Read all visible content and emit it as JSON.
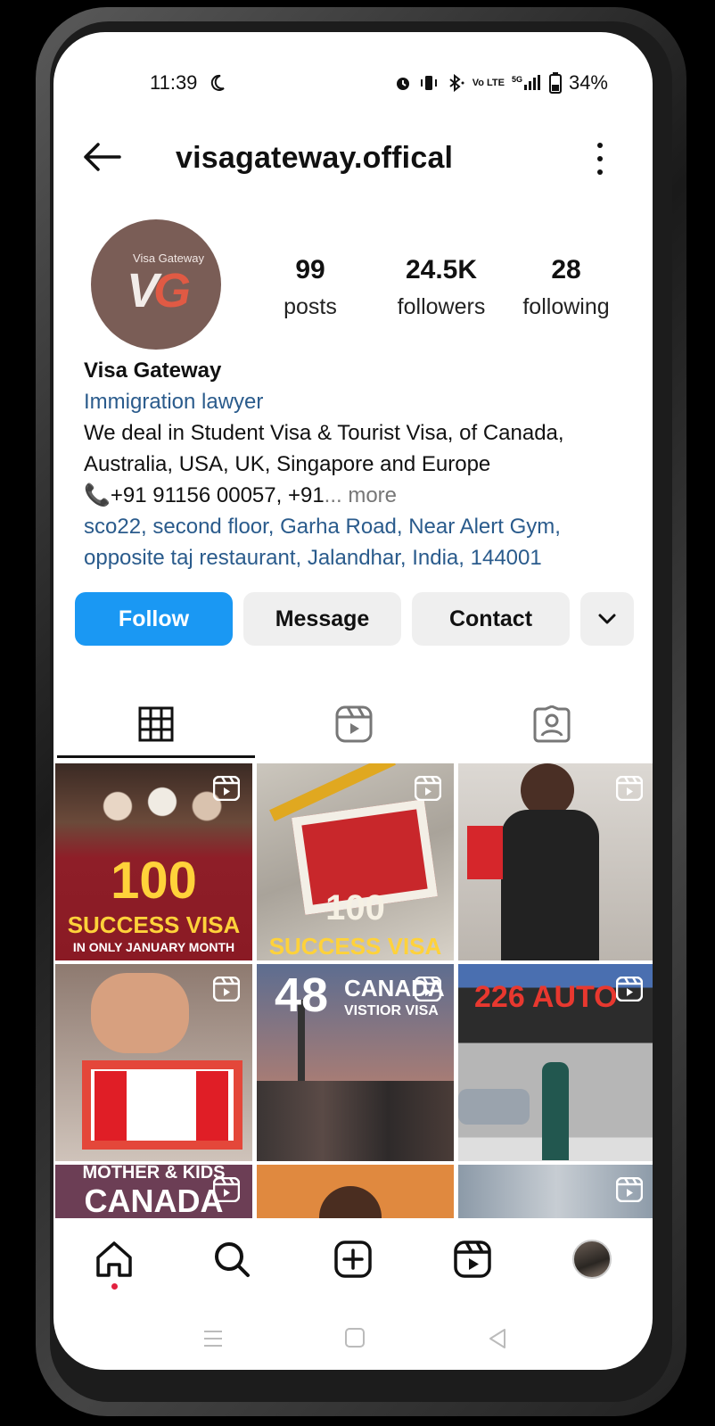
{
  "status_bar": {
    "time": "11:39",
    "battery_pct": "34%",
    "moon_icon": "moon-icon",
    "network_label": "5G",
    "volte_label": "Vo LTE"
  },
  "header": {
    "username": "visagateway.offical"
  },
  "profile": {
    "avatar_brand": "Visa Gateway",
    "avatar_logo_v": "V",
    "avatar_logo_g": "G",
    "posts_count": "99",
    "posts_label": "posts",
    "followers_count": "24.5K",
    "followers_label": "followers",
    "following_count": "28",
    "following_label": "following",
    "display_name": "Visa Gateway",
    "category": "Immigration lawyer",
    "bio_line1": "We deal in Student Visa & Tourist Visa, of Canada,",
    "bio_line2": "Australia, USA, UK, Singapore and Europe",
    "phone_line": "📞+91 91156 00057, +91",
    "more_label": "... more",
    "address_line1": "sco22, second floor, Garha Road, Near Alert Gym,",
    "address_line2": "opposite taj restaurant, Jalandhar, India, 144001"
  },
  "actions": {
    "follow": "Follow",
    "message": "Message",
    "contact": "Contact"
  },
  "grid": {
    "post1_line1": "100",
    "post1_line2": "SUCCESS VISA",
    "post1_line3": "IN ONLY JANUARY MONTH",
    "post2_line1": "100",
    "post2_line2": "SUCCESS VISA",
    "post4_text": "",
    "post5_line1": "48",
    "post5_line2": "CANADA",
    "post5_line3": "VISTIOR VISA",
    "post6_line1": "226 AUTO",
    "post7_line1": "MOTHER & KIDS",
    "post7_line2": "CANADA"
  },
  "colors": {
    "follow_blue": "#1a98f3",
    "link_blue": "#2a5b8c",
    "notification_red": "#e2213f"
  }
}
